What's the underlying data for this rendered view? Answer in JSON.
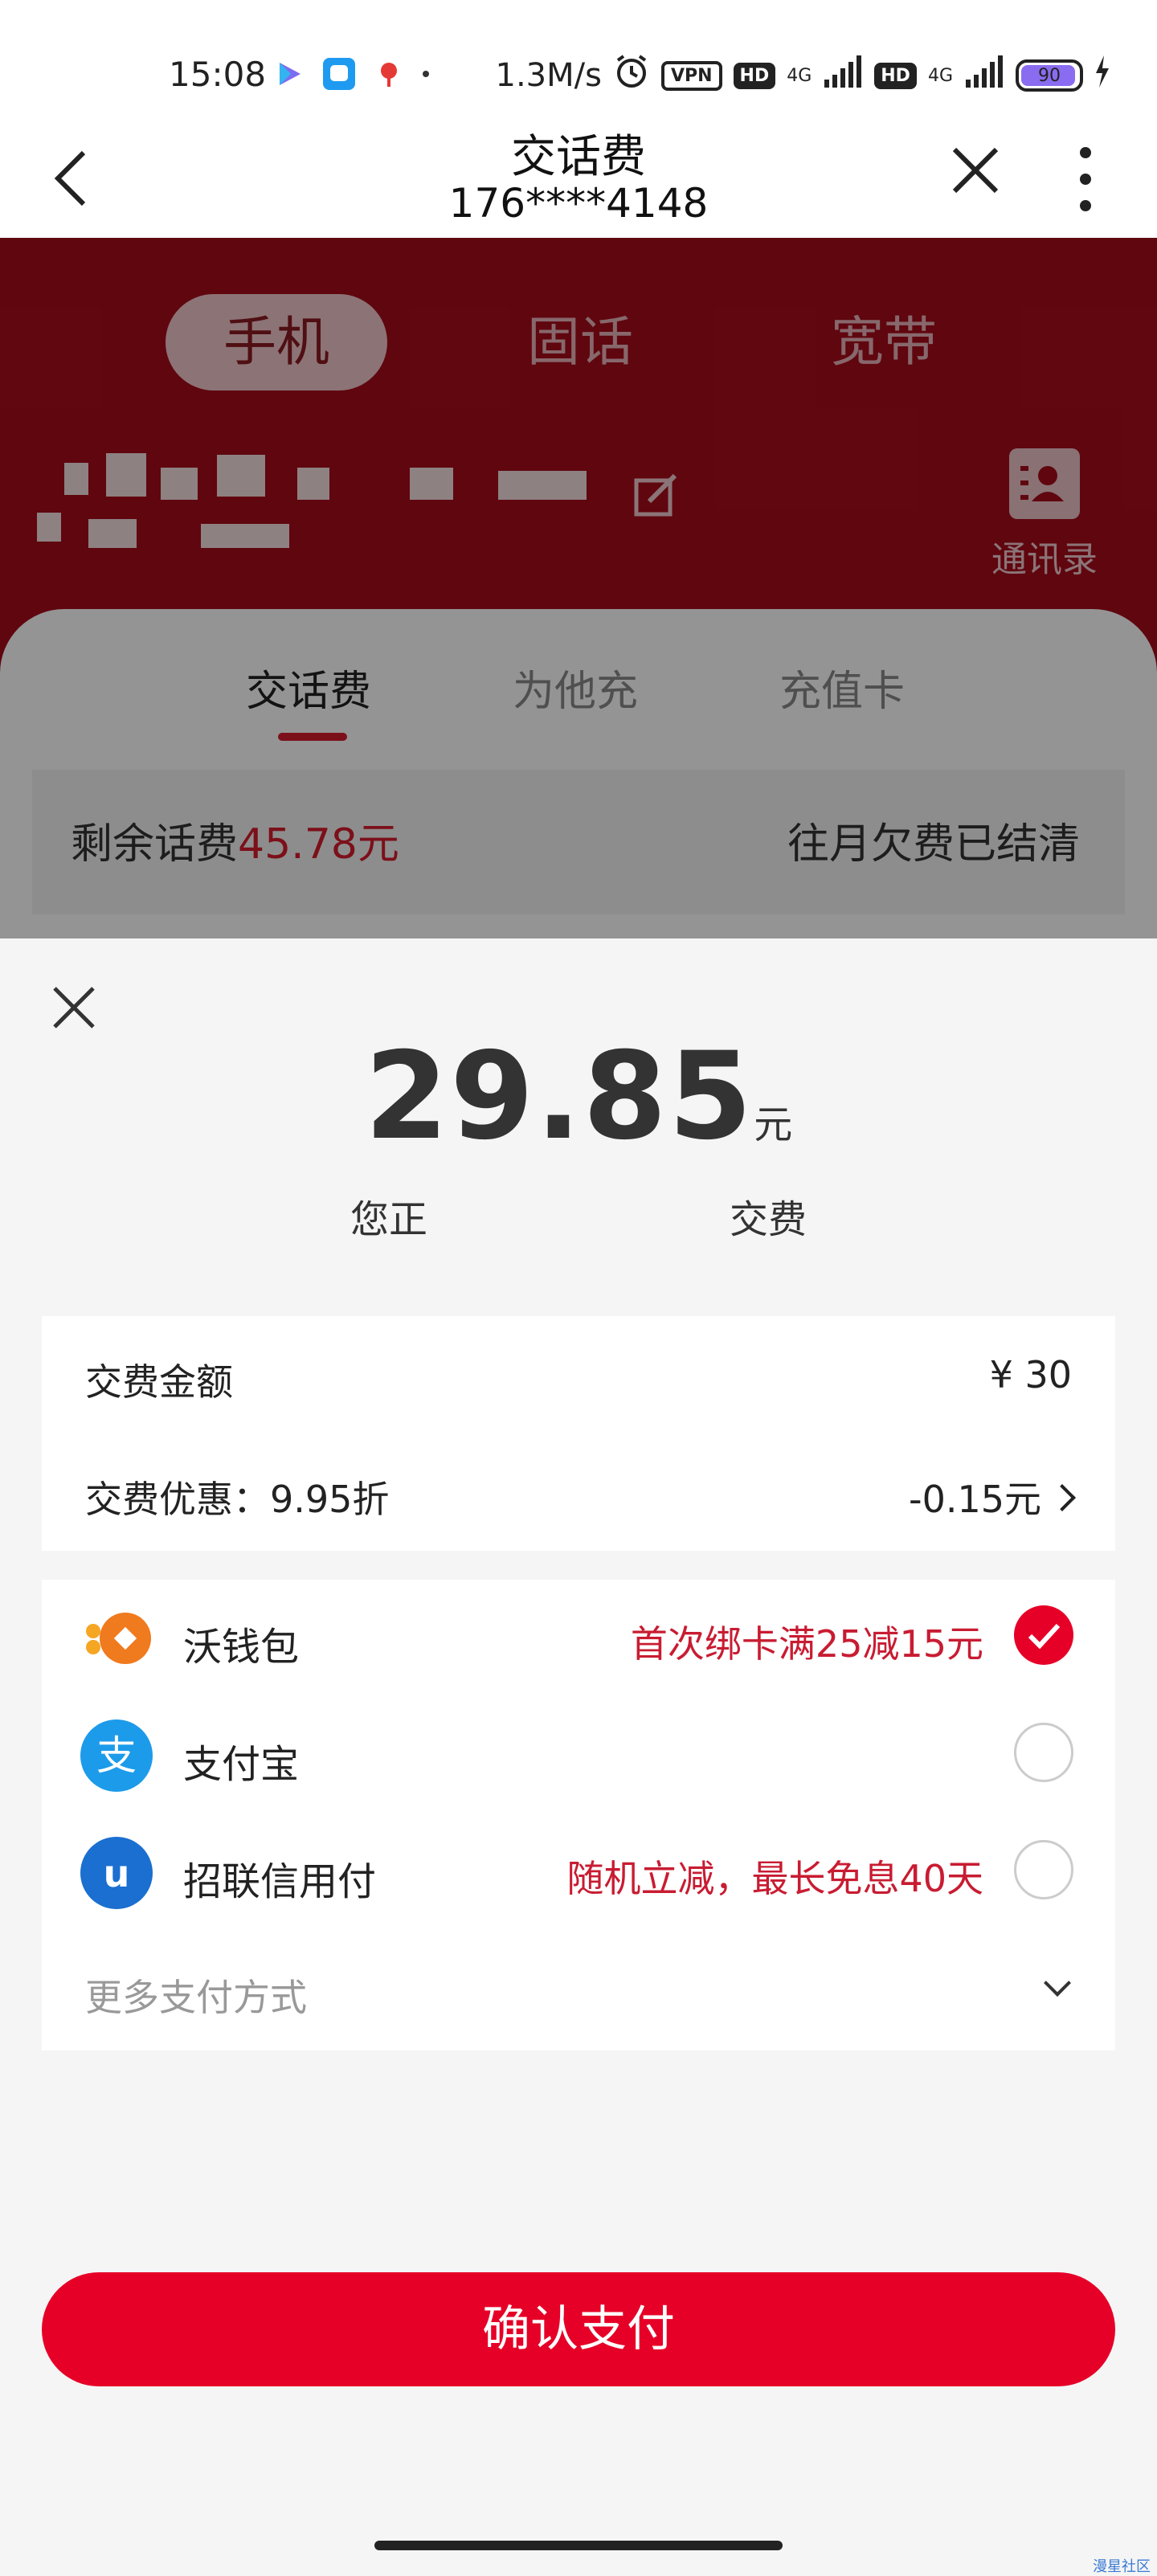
{
  "status_bar": {
    "time": "15:08",
    "speed": "1.3M/s",
    "vpn": "VPN",
    "hd1": "HD",
    "net1": "4G",
    "hd2": "HD",
    "net2": "4G",
    "battery": "90"
  },
  "header": {
    "title": "交话费",
    "subtitle": "176****4148"
  },
  "background_page": {
    "segments": [
      "手机",
      "固话",
      "宽带"
    ],
    "contacts_label": "通讯录",
    "tabs": [
      "交话费",
      "为他充",
      "充值卡"
    ],
    "balance_label": "剩余话费",
    "balance_value": "45.78元",
    "arrears_status": "往月欠费已结清"
  },
  "sheet": {
    "amount": "29.85",
    "unit": "元",
    "notice_start": "您正",
    "notice_end": "交费",
    "summary": {
      "fee_label": "交费金额",
      "fee_value": "¥ 30",
      "discount_label": "交费优惠：9.95折",
      "discount_value": "-0.15元"
    },
    "payment_methods": [
      {
        "name": "沃钱包",
        "promo": "首次绑卡满25减15元",
        "selected": true
      },
      {
        "name": "支付宝",
        "promo": "",
        "selected": false
      },
      {
        "name": "招联信用付",
        "promo": "随机立减，最长免息40天",
        "selected": false
      }
    ],
    "more_methods": "更多支付方式",
    "confirm_label": "确认支付"
  },
  "watermark": "漫星社区",
  "colors": {
    "brand_red": "#e60027",
    "promo_red": "#c81c32",
    "bg_red": "#a50c1b"
  }
}
